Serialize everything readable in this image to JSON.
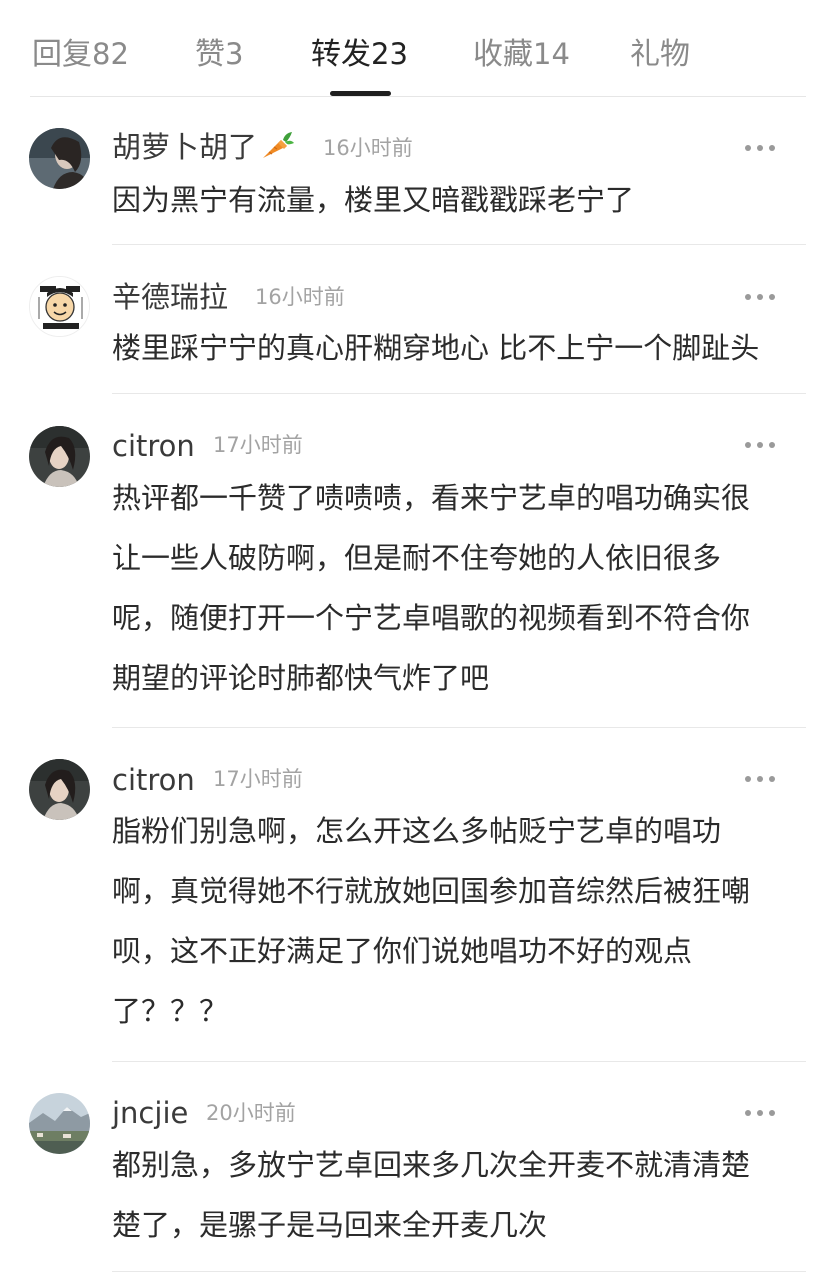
{
  "tabs": [
    {
      "label": "回复",
      "count": "82",
      "active": false
    },
    {
      "label": "赞",
      "count": "3",
      "active": false
    },
    {
      "label": "转发",
      "count": "23",
      "active": true
    },
    {
      "label": "收藏",
      "count": "14",
      "active": false
    },
    {
      "label": "礼物",
      "count": "",
      "active": false
    }
  ],
  "comments": [
    {
      "username": "胡萝卜胡了",
      "username_icon": "carrot-icon",
      "time": "16小时前",
      "lines": [
        "因为黑宁有流量，楼里又暗戳戳踩老宁了"
      ]
    },
    {
      "username": "辛德瑞拉",
      "time": "16小时前",
      "lines": [
        "楼里踩宁宁的真心肝糊穿地心 比不上宁一个脚趾头"
      ]
    },
    {
      "username": "citron",
      "time": "17小时前",
      "lines": [
        "热评都一千赞了啧啧啧，看来宁艺卓的唱功确实很",
        "让一些人破防啊，但是耐不住夸她的人依旧很多",
        "呢，随便打开一个宁艺卓唱歌的视频看到不符合你",
        "期望的评论时肺都快气炸了吧"
      ]
    },
    {
      "username": "citron",
      "time": "17小时前",
      "lines": [
        "脂粉们别急啊，怎么开这么多帖贬宁艺卓的唱功",
        "啊，真觉得她不行就放她回国参加音综然后被狂嘲",
        "呗，这不正好满足了你们说她唱功不好的观点",
        "了？？？"
      ]
    },
    {
      "username": "jncjie",
      "time": "20小时前",
      "lines": [
        "都别急，多放宁艺卓回来多几次全开麦不就清清楚",
        "楚了，是骡子是马回来全开麦几次"
      ]
    }
  ],
  "colors": {
    "tab_active": "#222222",
    "tab_inactive": "#8a8a8a",
    "time": "#a3a3a3",
    "divider": "#e8e8e8"
  }
}
